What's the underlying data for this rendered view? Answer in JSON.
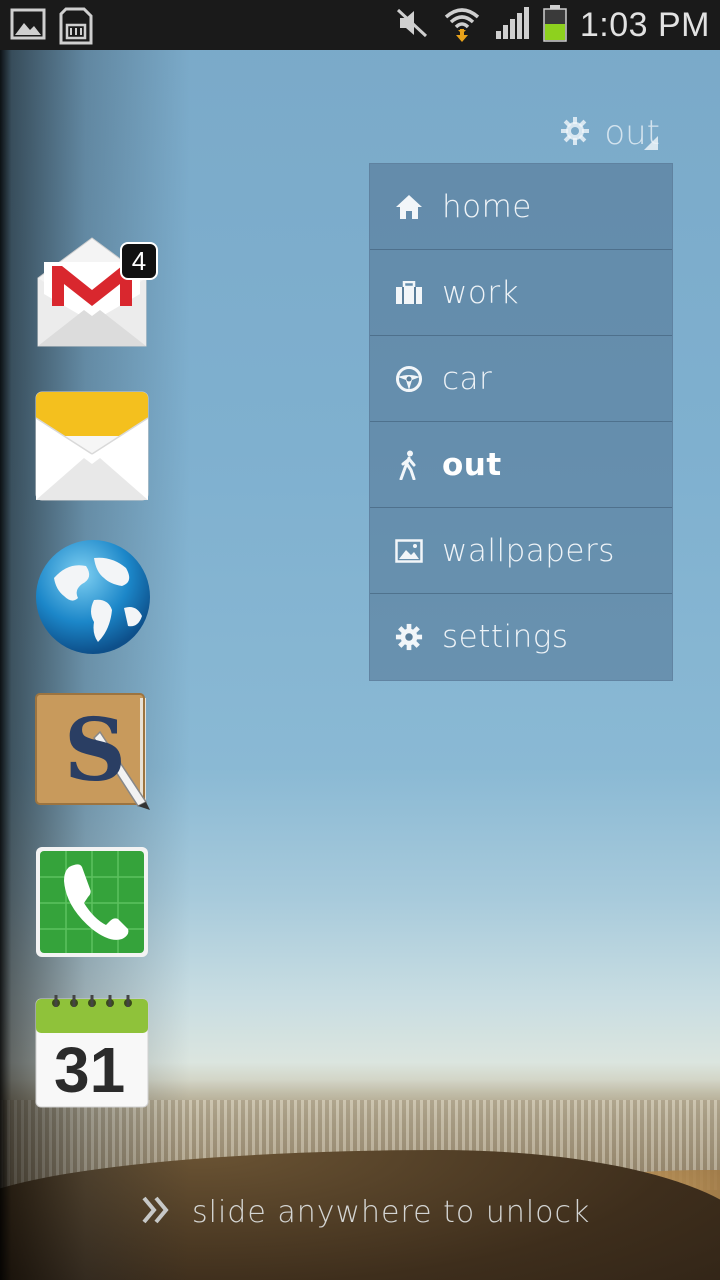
{
  "status_bar": {
    "time": "1:03 PM",
    "icons": [
      "gallery-icon",
      "sd-card-icon",
      "mute-icon",
      "wifi-icon",
      "signal-icon",
      "battery-icon"
    ]
  },
  "profile": {
    "current": "out",
    "icon": "gear-icon"
  },
  "menu": {
    "items": [
      {
        "label": "home",
        "icon": "home-icon",
        "active": false
      },
      {
        "label": "work",
        "icon": "briefcase-icon",
        "active": false
      },
      {
        "label": "car",
        "icon": "steering-wheel-icon",
        "active": false
      },
      {
        "label": "out",
        "icon": "walking-icon",
        "active": true
      },
      {
        "label": "wallpapers",
        "icon": "image-icon",
        "active": false
      },
      {
        "label": "settings",
        "icon": "gear-icon",
        "active": false
      }
    ]
  },
  "apps": [
    {
      "name": "gmail",
      "icon": "gmail-icon",
      "badge": "4"
    },
    {
      "name": "email",
      "icon": "email-icon"
    },
    {
      "name": "internet",
      "icon": "globe-icon"
    },
    {
      "name": "s-note",
      "icon": "s-note-icon",
      "glyph": "S"
    },
    {
      "name": "phone",
      "icon": "phone-icon"
    },
    {
      "name": "calendar",
      "icon": "calendar-icon",
      "date": "31"
    }
  ],
  "unlock": {
    "text": "slide anywhere to unlock"
  },
  "colors": {
    "menu_bg": "#50738f",
    "menu_text": "#eef4f8",
    "status_bar_bg": "#1a1a1a",
    "gmail_red": "#d9272e",
    "battery_green": "#8ed11e"
  }
}
